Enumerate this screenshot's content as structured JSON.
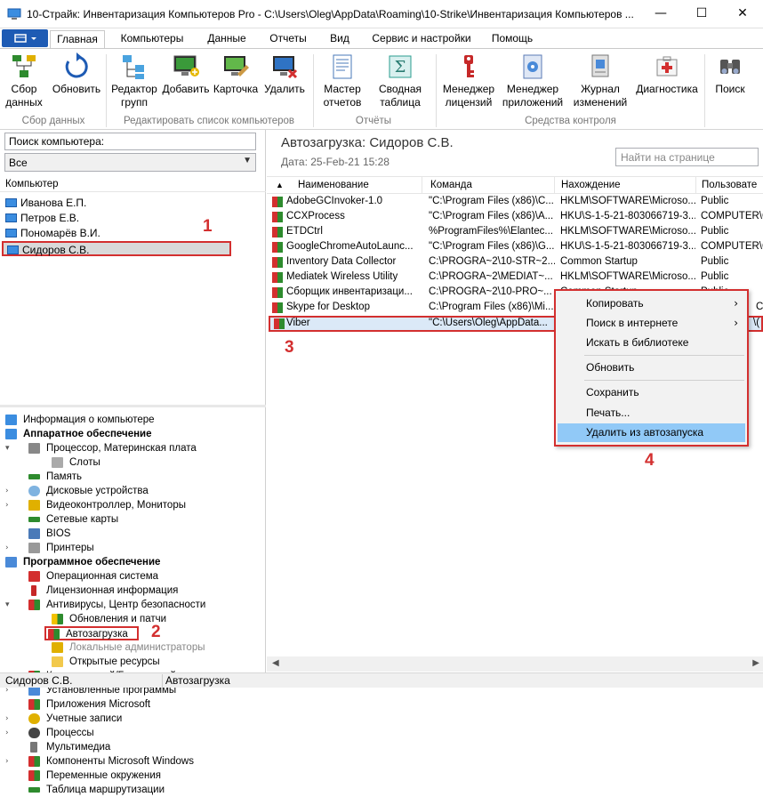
{
  "window": {
    "title": "10-Страйк: Инвентаризация Компьютеров Pro - C:\\Users\\Oleg\\AppData\\Roaming\\10-Strike\\Инвентаризация Компьютеров ...",
    "minimize": "—",
    "maximize": "☐",
    "close": "✕"
  },
  "menu": {
    "tabs": [
      "Главная",
      "Компьютеры",
      "Данные",
      "Отчеты",
      "Вид",
      "Сервис и настройки",
      "Помощь"
    ]
  },
  "ribbon": {
    "buttons": [
      {
        "l1": "Сбор",
        "l2": "данных"
      },
      {
        "l1": "Обновить",
        "l2": ""
      },
      {
        "l1": "Редактор",
        "l2": "групп"
      },
      {
        "l1": "Добавить",
        "l2": ""
      },
      {
        "l1": "Карточка",
        "l2": ""
      },
      {
        "l1": "Удалить",
        "l2": ""
      },
      {
        "l1": "Мастер",
        "l2": "отчетов"
      },
      {
        "l1": "Сводная",
        "l2": "таблица"
      },
      {
        "l1": "Менеджер",
        "l2": "лицензий"
      },
      {
        "l1": "Менеджер",
        "l2": "приложений"
      },
      {
        "l1": "Журнал",
        "l2": "изменений"
      },
      {
        "l1": "Диагностика",
        "l2": ""
      },
      {
        "l1": "Поиск",
        "l2": ""
      }
    ],
    "groups": [
      "Сбор данных",
      "Редактировать список компьютеров",
      "Отчёты",
      "Средства контроля"
    ]
  },
  "left": {
    "search_value": "Поиск компьютера:",
    "filter_value": "Все",
    "list_header": "Компьютер",
    "computers": [
      "Иванова Е.П.",
      "Петров Е.В.",
      "Пономарёв В.И.",
      "Сидоров С.В."
    ],
    "tree": [
      "Информация о компьютере",
      "Аппаратное обеспечение",
      "Процессор, Материнская плата",
      "Слоты",
      "Память",
      "Дисковые устройства",
      "Видеоконтроллер, Мониторы",
      "Сетевые карты",
      "BIOS",
      "Принтеры",
      "Программное обеспечение",
      "Операционная система",
      "Лицензионная информация",
      "Антивирусы, Центр безопасности",
      "Обновления и патчи",
      "Автозагрузка",
      "Локальные администраторы",
      "Открытые ресурсы",
      "Коммерческий/Бесплатный",
      "Установленные программы",
      "Приложения Microsoft",
      "Учетные записи",
      "Процессы",
      "Мультимедиа",
      "Компоненты Microsoft Windows",
      "Переменные окружения",
      "Таблица маршрутизации"
    ]
  },
  "right": {
    "title": "Автозагрузка: Сидоров С.В.",
    "date": "Дата: 25-Feb-21 15:28",
    "find_placeholder": "Найти на странице",
    "columns": [
      "Наименование",
      "Команда",
      "Нахождение",
      "Пользовате"
    ],
    "rows": [
      [
        "AdobeGCInvoker-1.0",
        "\"C:\\Program Files (x86)\\C...",
        "HKLM\\SOFTWARE\\Microso...",
        "Public"
      ],
      [
        "CCXProcess",
        "\"C:\\Program Files (x86)\\A...",
        "HKU\\S-1-5-21-803066719-3...",
        "COMPUTER\\C"
      ],
      [
        "ETDCtrl",
        "%ProgramFiles%\\Elantec...",
        "HKLM\\SOFTWARE\\Microso...",
        "Public"
      ],
      [
        "GoogleChromeAutoLaunc...",
        "\"C:\\Program Files (x86)\\G...",
        "HKU\\S-1-5-21-803066719-3...",
        "COMPUTER\\C"
      ],
      [
        "Inventory Data Collector",
        "C:\\PROGRA~2\\10-STR~2...",
        "Common Startup",
        "Public"
      ],
      [
        "Mediatek Wireless Utility",
        "C:\\PROGRA~2\\MEDIAT~...",
        "HKLM\\SOFTWARE\\Microso...",
        "Public"
      ],
      [
        "Сборщик инвентаризаци...",
        "C:\\PROGRA~2\\10-PRO~...",
        "Common Startup",
        "Public"
      ],
      [
        "Skype for Desktop",
        "C:\\Program Files (x86)\\Mi...",
        "",
        "C"
      ],
      [
        "Viber",
        "\"C:\\Users\\Oleg\\AppData...",
        "",
        "\\("
      ]
    ]
  },
  "context_menu": {
    "items": [
      "Копировать",
      "Поиск в интернете",
      "Искать в библиотеке",
      "Обновить",
      "Сохранить",
      "Печать...",
      "Удалить из автозапуска"
    ]
  },
  "annotations": [
    "1",
    "2",
    "3",
    "4"
  ],
  "status": {
    "computer": "Сидоров С.В.",
    "section": "Автозагрузка"
  }
}
